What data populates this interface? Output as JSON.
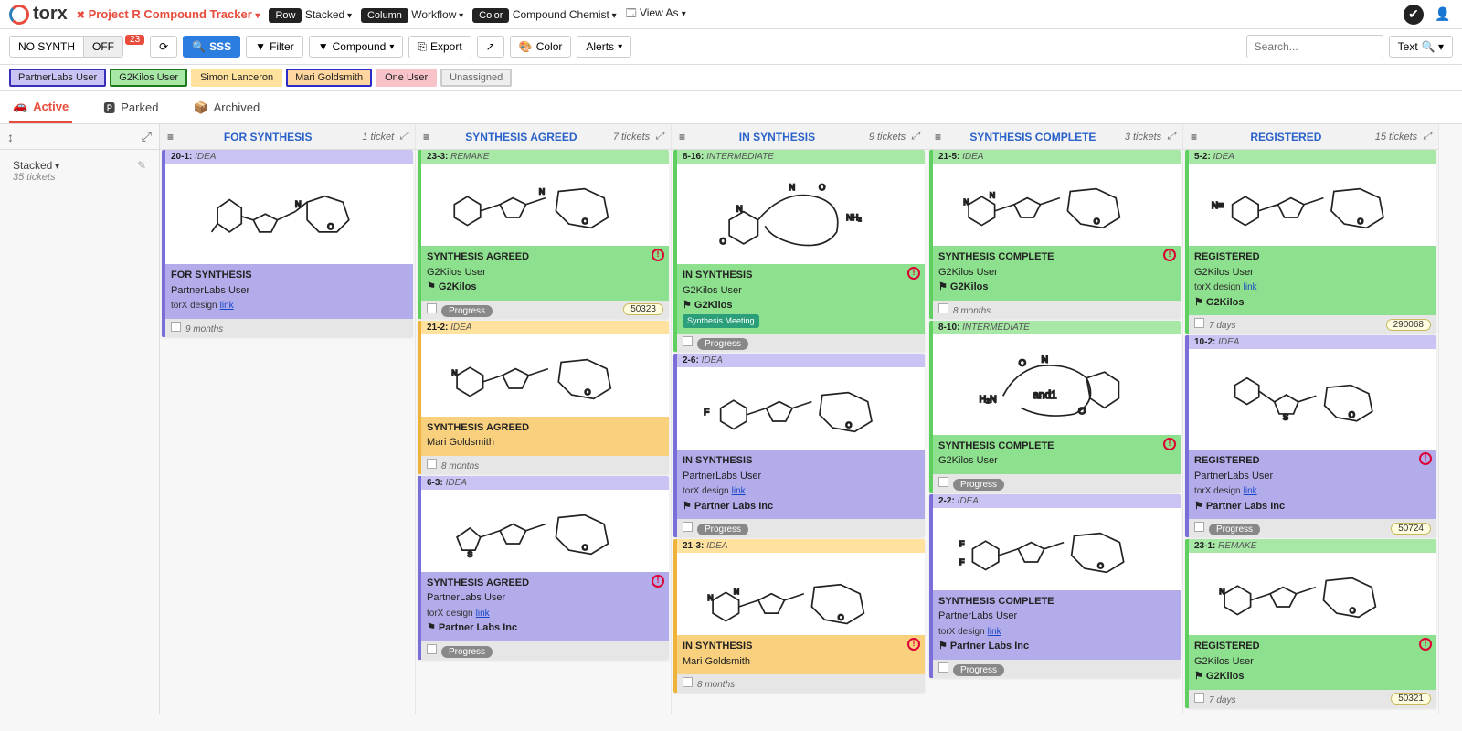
{
  "logo": "torx",
  "project": "Project R Compound Tracker",
  "topControls": {
    "rowLabel": "Row",
    "rowValue": "Stacked",
    "colLabel": "Column",
    "colValue": "Workflow",
    "colorLabel": "Color",
    "colorValue": "Compound Chemist",
    "viewAs": "View As"
  },
  "toolbar": {
    "noSynth": "NO SYNTH",
    "off": "OFF",
    "offBadge": "23",
    "sss": "SSS",
    "filter": "Filter",
    "compound": "Compound",
    "export": "Export",
    "color": "Color",
    "alerts": "Alerts",
    "searchPlaceholder": "Search...",
    "text": "Text"
  },
  "users": [
    {
      "cls": "purple",
      "name": "PartnerLabs User"
    },
    {
      "cls": "green",
      "name": "G2Kilos User"
    },
    {
      "cls": "yellow",
      "name": "Simon Lanceron"
    },
    {
      "cls": "orange",
      "name": "Mari Goldsmith"
    },
    {
      "cls": "pink",
      "name": "One User"
    },
    {
      "cls": "grey",
      "name": "Unassigned"
    }
  ],
  "tabs": {
    "active": "Active",
    "parked": "Parked",
    "archived": "Archived"
  },
  "leftPanel": {
    "stacked": "Stacked",
    "count": "35 tickets"
  },
  "columns": [
    {
      "title": "FOR SYNTHESIS",
      "meta": "1 ticket"
    },
    {
      "title": "SYNTHESIS AGREED",
      "meta": "7 tickets"
    },
    {
      "title": "IN SYNTHESIS",
      "meta": "9 tickets"
    },
    {
      "title": "SYNTHESIS COMPLETE",
      "meta": "3 tickets"
    },
    {
      "title": "REGISTERED",
      "meta": "15 tickets"
    }
  ],
  "labels": {
    "idea": "IDEA",
    "remake": "REMAKE",
    "intermediate": "INTERMEDIATE",
    "progress": "Progress",
    "link": "link",
    "torx": "torX design",
    "synthMeeting": "Synthesis Meeting"
  },
  "cards": {
    "c1": {
      "id": "20-1:",
      "stage": "FOR SYNTHESIS",
      "who": "PartnerLabs User",
      "foot": "9 months"
    },
    "c2": {
      "id": "23-3:",
      "stage": "SYNTHESIS AGREED",
      "who": "G2Kilos User",
      "org": "G2Kilos",
      "pill": "50323"
    },
    "c3": {
      "id": "21-2:",
      "stage": "SYNTHESIS AGREED",
      "who": "Mari Goldsmith",
      "foot": "8 months"
    },
    "c4": {
      "id": "6-3:",
      "stage": "SYNTHESIS AGREED",
      "who": "PartnerLabs User",
      "org": "Partner Labs Inc"
    },
    "c5": {
      "id": "8-16:",
      "stage": "IN SYNTHESIS",
      "who": "G2Kilos User",
      "org": "G2Kilos"
    },
    "c6": {
      "id": "2-6:",
      "stage": "IN SYNTHESIS",
      "who": "PartnerLabs User",
      "org": "Partner Labs Inc"
    },
    "c7": {
      "id": "21-3:",
      "stage": "IN SYNTHESIS",
      "who": "Mari Goldsmith",
      "foot": "8 months"
    },
    "c8": {
      "id": "21-5:",
      "stage": "SYNTHESIS COMPLETE",
      "who": "G2Kilos User",
      "org": "G2Kilos",
      "foot": "8 months"
    },
    "c9": {
      "id": "8-10:",
      "stage": "SYNTHESIS COMPLETE",
      "who": "G2Kilos User",
      "ann": "and1"
    },
    "c10": {
      "id": "2-2:",
      "stage": "SYNTHESIS COMPLETE",
      "who": "PartnerLabs User",
      "org": "Partner Labs Inc"
    },
    "c11": {
      "id": "5-2:",
      "stage": "REGISTERED",
      "who": "G2Kilos User",
      "org": "G2Kilos",
      "foot": "7 days",
      "pill": "290068"
    },
    "c12": {
      "id": "10-2:",
      "stage": "REGISTERED",
      "who": "PartnerLabs User",
      "org": "Partner Labs Inc",
      "pill": "50724"
    },
    "c13": {
      "id": "23-1:",
      "stage": "REGISTERED",
      "who": "G2Kilos User",
      "org": "G2Kilos",
      "foot": "7 days",
      "pill": "50321"
    }
  }
}
